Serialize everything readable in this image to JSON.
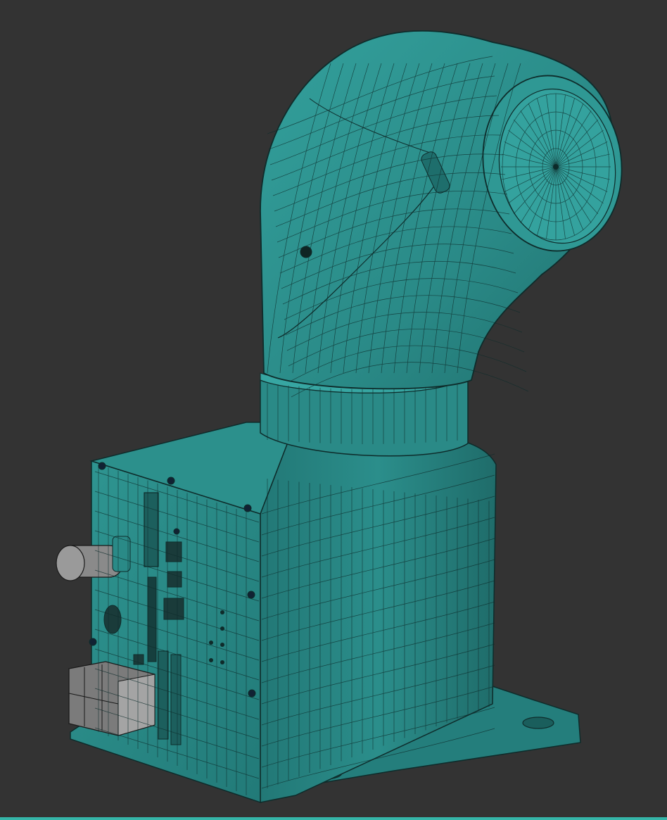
{
  "scene": {
    "subject": "",
    "render_style": "wireframe-on-shaded",
    "background_color": "#333333",
    "body_color": "#2a8c8a",
    "body_shadow_color": "#1f6f6d",
    "body_highlight_color": "#39a3a0",
    "wire_color": "#0e2c2b",
    "part_gray_color": "#8a8a8a",
    "accent_bar_color": "#35b5a8"
  }
}
